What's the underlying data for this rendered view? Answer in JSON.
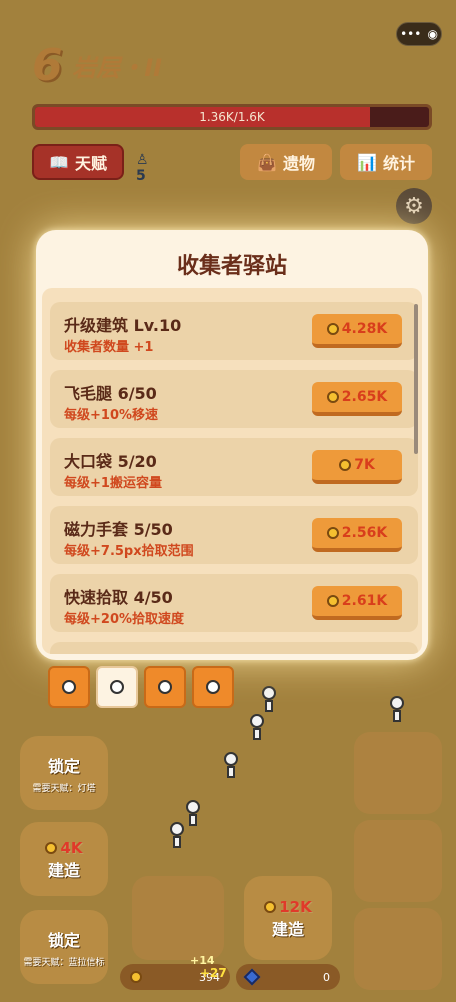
{
  "window": {
    "capsule_more": "•••",
    "capsule_close": "◉"
  },
  "header": {
    "level_number": "6",
    "level_name": "岩层・II"
  },
  "hp": {
    "text": "1.36K/1.6K",
    "fraction": 0.85
  },
  "top_buttons": {
    "talent": "天赋",
    "relic": "遗物",
    "stats": "统计"
  },
  "worker_count": "5",
  "modal": {
    "title": "收集者驿站",
    "items": [
      {
        "name": "升级建筑 Lv.10",
        "desc": "收集者数量 +1",
        "price": "4.28K"
      },
      {
        "name": "飞毛腿 6/50",
        "desc": "每级+10%移速",
        "price": "2.65K"
      },
      {
        "name": "大口袋 5/20",
        "desc": "每级+1搬运容量",
        "price": "7K"
      },
      {
        "name": "磁力手套 5/50",
        "desc": "每级+7.5px拾取范围",
        "price": "2.56K"
      },
      {
        "name": "快速拾取 4/50",
        "desc": "每级+20%拾取速度",
        "price": "2.61K"
      }
    ]
  },
  "side": {
    "lock1": "锁定",
    "lock1_req": "需要天赋：灯塔",
    "build1_price": "4K",
    "build1": "建造",
    "lock2": "锁定",
    "lock2_req": "需要天赋：蓝拉信标",
    "build2_price": "12K",
    "build2": "建造"
  },
  "bottom": {
    "coins": "394",
    "gems": "0",
    "popup1": "+14",
    "popup2": "+27"
  }
}
